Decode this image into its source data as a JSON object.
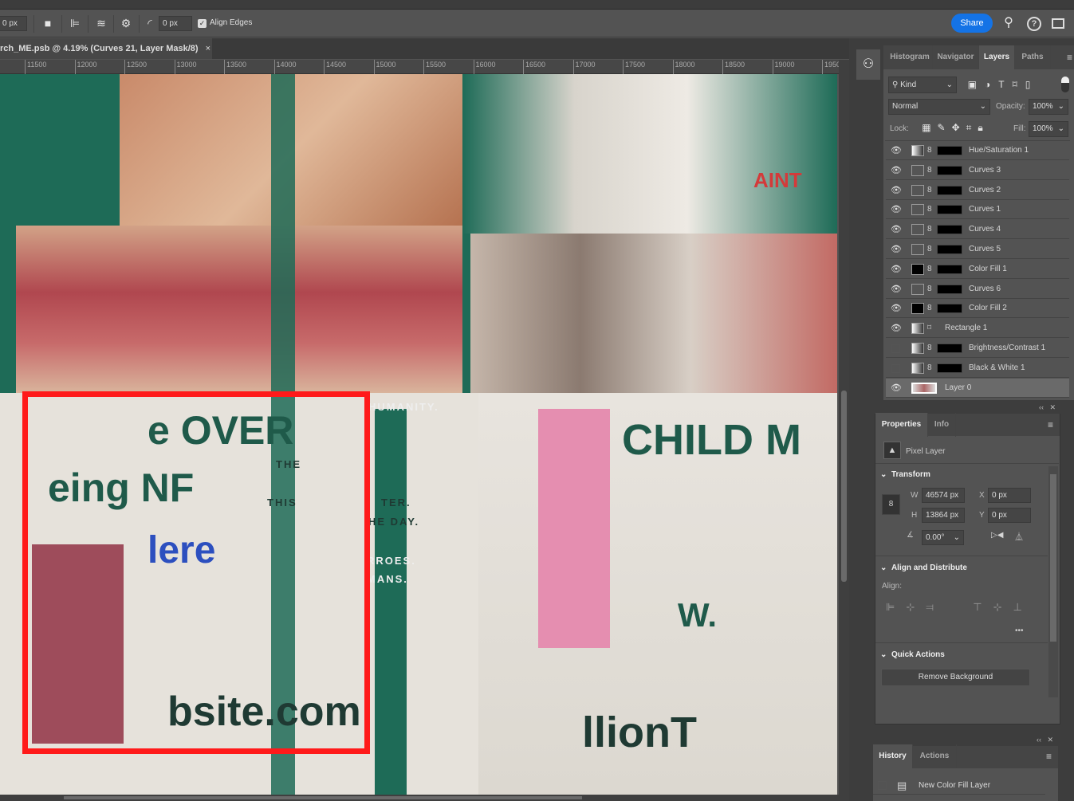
{
  "options_bar": {
    "width_value": "0 px",
    "radius_value": "0 px",
    "align_edges_label": "Align Edges",
    "align_edges_checked": true,
    "share_label": "Share"
  },
  "document_tab": {
    "title": "rch_ME.psb @ 4.19% (Curves 21, Layer Mask/8)",
    "close": "×"
  },
  "ruler": {
    "ticks": [
      "11500",
      "12000",
      "12500",
      "13000",
      "13500",
      "14000",
      "14500",
      "15000",
      "15500",
      "16000",
      "16500",
      "17000",
      "17500",
      "18000",
      "18500",
      "19000",
      "1950"
    ]
  },
  "canvas": {
    "poster_text": [
      "e OVER",
      "eing NF",
      "lere",
      "bsite.com",
      "HUMANITY.",
      "TER.",
      "HE DAY.",
      "RROES.",
      "MANS.",
      "CHILD M",
      "AINT",
      "llionT",
      "W.",
      "THE",
      "THIS"
    ],
    "highlight_color": "#ff0000"
  },
  "layers_panel": {
    "tabs": [
      "Histogram",
      "Navigator",
      "Layers",
      "Paths"
    ],
    "active_tab": "Layers",
    "filter_kind": "Kind",
    "blend_mode": "Normal",
    "opacity_label": "Opacity:",
    "opacity": "100%",
    "lock_label": "Lock:",
    "fill_label": "Fill:",
    "fill": "100%",
    "layers": [
      {
        "name": "Hue/Saturation 1",
        "visible": true,
        "type": "adjustment"
      },
      {
        "name": "Curves 3",
        "visible": true,
        "type": "curves"
      },
      {
        "name": "Curves 2",
        "visible": true,
        "type": "curves"
      },
      {
        "name": "Curves 1",
        "visible": true,
        "type": "curves"
      },
      {
        "name": "Curves 4",
        "visible": true,
        "type": "curves"
      },
      {
        "name": "Curves 5",
        "visible": true,
        "type": "curves"
      },
      {
        "name": "Color Fill 1",
        "visible": true,
        "type": "fill"
      },
      {
        "name": "Curves 6",
        "visible": true,
        "type": "curves"
      },
      {
        "name": "Color Fill 2",
        "visible": true,
        "type": "fill"
      },
      {
        "name": "Rectangle 1",
        "visible": true,
        "type": "shape"
      },
      {
        "name": "Brightness/Contrast 1",
        "visible": false,
        "type": "adjustment"
      },
      {
        "name": "Black & White 1",
        "visible": false,
        "type": "adjustment"
      },
      {
        "name": "Layer 0",
        "visible": true,
        "type": "pixel",
        "selected": true
      }
    ]
  },
  "properties_panel": {
    "tabs": [
      "Properties",
      "Info"
    ],
    "layer_kind": "Pixel Layer",
    "transform_title": "Transform",
    "w_label": "W",
    "w": "46574 px",
    "h_label": "H",
    "h": "13864 px",
    "x_label": "X",
    "x": "0 px",
    "y_label": "Y",
    "y": "0 px",
    "angle": "0.00°",
    "align_title": "Align and Distribute",
    "align_label": "Align:",
    "more": "•••",
    "quick_actions_title": "Quick Actions",
    "remove_bg_label": "Remove Background"
  },
  "history_panel": {
    "tabs": [
      "History",
      "Actions"
    ],
    "items": [
      "New Color Fill Layer"
    ]
  }
}
